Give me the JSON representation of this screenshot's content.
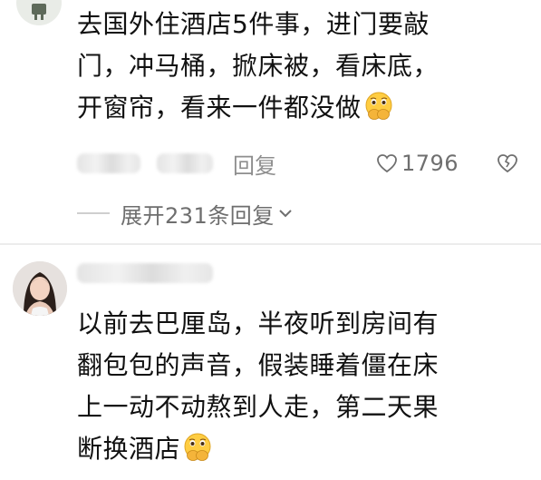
{
  "comment1": {
    "lines": [
      "去国外住酒店5件事，进门要敲",
      "门，冲马桶，掀床被，看床底，",
      "开窗帘，看来一件都没做"
    ],
    "emoji": "grimacing-hands-emoji",
    "reply_label": "回复",
    "likes": "1796",
    "expand_label": "展开231条回复"
  },
  "comment2": {
    "lines": [
      "以前去巴厘岛，半夜听到房间有",
      "翻包包的声音，假装睡着僵在床",
      "上一动不动熬到人走，第二天果",
      "断换酒店"
    ],
    "emoji": "grimacing-hands-emoji"
  },
  "colors": {
    "text": "#111111",
    "meta": "#8e8e8e",
    "icon": "#6f6f6f",
    "divider": "#ececec"
  }
}
